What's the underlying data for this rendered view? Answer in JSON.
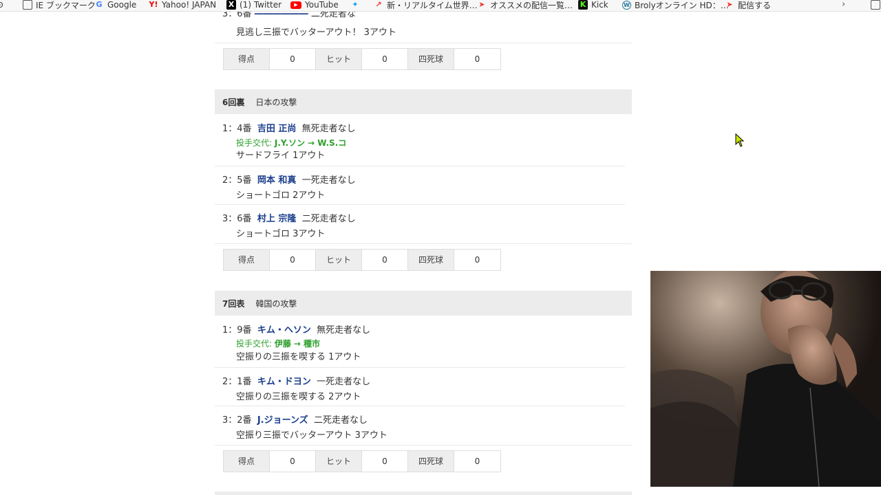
{
  "bookmarks": [
    {
      "label": "IE ブックマーク",
      "icon": "folder-icon"
    },
    {
      "label": "Google",
      "icon": "google-icon"
    },
    {
      "label": "Yahoo! JAPAN",
      "icon": "yahoo-icon"
    },
    {
      "label": "(1) Twitter",
      "icon": "x-icon"
    },
    {
      "label": "YouTube",
      "icon": "youtube-icon"
    },
    {
      "label": "",
      "icon": "twitter-bird-icon"
    },
    {
      "label": "新・リアルタイム世界…",
      "icon": "chart-icon"
    },
    {
      "label": "オススメの配信一覧…",
      "icon": "stream-icon"
    },
    {
      "label": "Kick",
      "icon": "kick-icon"
    },
    {
      "label": "Brolyオンライン HD：…",
      "icon": "wordpress-icon"
    },
    {
      "label": "配信する",
      "icon": "stream-icon"
    }
  ],
  "top_partial": {
    "result": "見逃し三振でバッターアウト！ 3アウト"
  },
  "stat_labels": {
    "score": "得点",
    "hits": "ヒット",
    "walks": "四死球"
  },
  "stats_block_1": {
    "score": "0",
    "hits": "0",
    "walks": "0"
  },
  "inning_6": {
    "inning": "6回裏",
    "team": "日本の攻撃",
    "plays": [
      {
        "order": "1：4番",
        "player": "吉田 正尚",
        "situation": "無死走者なし",
        "change_label": "投手交代:",
        "change_from": "J.Y.ソン",
        "change_to": "→ W.S.コ",
        "result": "サードフライ 1アウト"
      },
      {
        "order": "2：5番",
        "player": "岡本 和真",
        "situation": "一死走者なし",
        "result": "ショートゴロ 2アウト"
      },
      {
        "order": "3：6番",
        "player": "村上 宗隆",
        "situation": "二死走者なし",
        "result": "ショートゴロ 3アウト"
      }
    ],
    "stats": {
      "score": "0",
      "hits": "0",
      "walks": "0"
    }
  },
  "inning_7": {
    "inning": "7回表",
    "team": "韓国の攻撃",
    "plays": [
      {
        "order": "1：9番",
        "player": "キム・ヘソン",
        "situation": "無死走者なし",
        "change_label": "投手交代:",
        "change_from": "伊藤",
        "change_to": "→ 種市",
        "result": "空振りの三振を喫する 1アウト"
      },
      {
        "order": "2：1番",
        "player": "キム・ドヨン",
        "situation": "一死走者なし",
        "result": "空振りの三振を喫する 2アウト"
      },
      {
        "order": "3：2番",
        "player": "J.ジョーンズ",
        "situation": "二死走者なし",
        "result": "空振り三振でバッターアウト 3アウト"
      }
    ],
    "stats": {
      "score": "0",
      "hits": "0",
      "walks": "0"
    }
  }
}
